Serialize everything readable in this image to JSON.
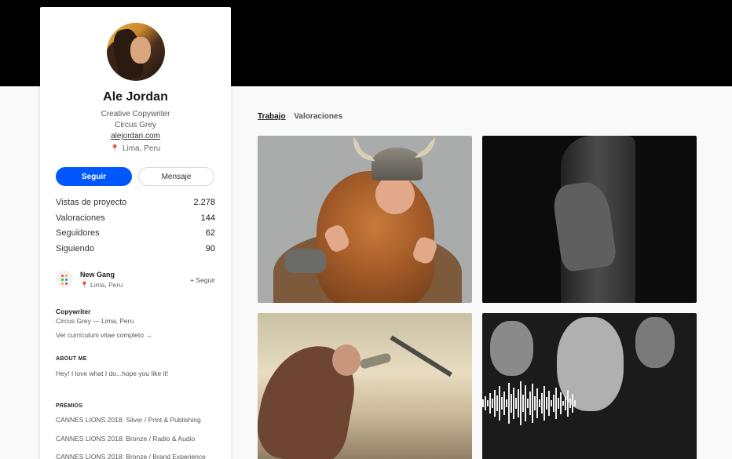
{
  "profile": {
    "name": "Ale Jordan",
    "occupation": "Creative Copywriter",
    "company": "Circus Grey",
    "website": "alejordan.com",
    "location": "Lima, Peru"
  },
  "actions": {
    "follow_label": "Seguir",
    "message_label": "Mensaje"
  },
  "stats": [
    {
      "label": "Vistas de proyecto",
      "value": "2.278"
    },
    {
      "label": "Valoraciones",
      "value": "144"
    },
    {
      "label": "Seguidores",
      "value": "62"
    },
    {
      "label": "Siguiendo",
      "value": "90"
    }
  ],
  "team": {
    "name": "New Gang",
    "location": "Lima, Peru",
    "follow_label": "+ Seguir"
  },
  "work": {
    "title": "Copywriter",
    "subtitle": "Circus Grey — Lima, Peru",
    "cv_link": "Ver currículum vitae completo →"
  },
  "about": {
    "heading": "ABOUT ME",
    "text": "Hey! I love what I do...hope you like it!"
  },
  "awards": {
    "heading": "PREMIOS",
    "items": [
      "CANNES LIONS 2018: Silver / Print & Publishing",
      "CANNES LIONS 2018: Bronze / Radio & Audio",
      "CANNES LIONS 2018: Bronze / Brand Experience"
    ]
  },
  "tabs": [
    {
      "label": "Trabajo",
      "active": true
    },
    {
      "label": "Valoraciones",
      "active": false
    }
  ],
  "colors": {
    "accent": "#0057ff",
    "banner": "#000000"
  },
  "icons": {
    "location": "location-pin-icon"
  }
}
